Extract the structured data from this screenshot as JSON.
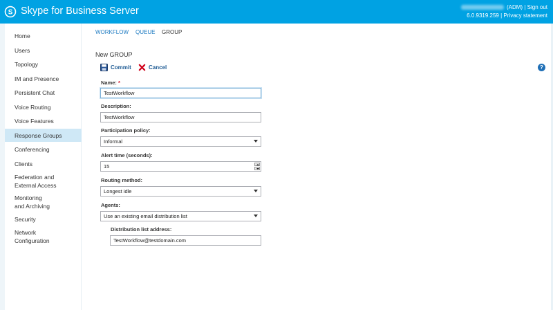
{
  "app": {
    "title": "Skype for Business Server"
  },
  "header": {
    "user_role": "(ADM)",
    "sign_out": "Sign out",
    "version": "6.0.9319.259",
    "privacy": "Privacy statement",
    "separator": "|"
  },
  "sidebar": {
    "items": [
      {
        "label": "Home"
      },
      {
        "label": "Users"
      },
      {
        "label": "Topology"
      },
      {
        "label": "IM and Presence"
      },
      {
        "label": "Persistent Chat"
      },
      {
        "label": "Voice Routing"
      },
      {
        "label": "Voice Features"
      },
      {
        "label": "Response Groups",
        "active": true
      },
      {
        "label": "Conferencing"
      },
      {
        "label": "Clients"
      },
      {
        "label": "Federation and",
        "label2": "External Access"
      },
      {
        "label": "Monitoring",
        "label2": "and Archiving"
      },
      {
        "label": "Security"
      },
      {
        "label": "Network",
        "label2": "Configuration"
      }
    ]
  },
  "tabs": [
    {
      "label": "WORKFLOW"
    },
    {
      "label": "QUEUE"
    },
    {
      "label": "GROUP"
    }
  ],
  "page": {
    "title": "New GROUP"
  },
  "toolbar": {
    "commit": "Commit",
    "cancel": "Cancel",
    "help": "?"
  },
  "form": {
    "name": {
      "label": "Name:",
      "required_mark": "*",
      "value": "TestWorkflow"
    },
    "description": {
      "label": "Description:",
      "value": "TestWorkflow"
    },
    "participation_policy": {
      "label": "Participation policy:",
      "value": "Informal"
    },
    "alert_time": {
      "label": "Alert time (seconds):",
      "value": "15"
    },
    "routing_method": {
      "label": "Routing method:",
      "value": "Longest idle"
    },
    "agents": {
      "label": "Agents:",
      "value": "Use an existing email distribution list"
    },
    "distribution_list": {
      "label": "Distribution list address:",
      "value": "TestWorkflow@testdomain.com"
    }
  },
  "colors": {
    "header": "#00a2e3",
    "active_nav": "#cfe8f6",
    "link": "#1e7bc2"
  }
}
